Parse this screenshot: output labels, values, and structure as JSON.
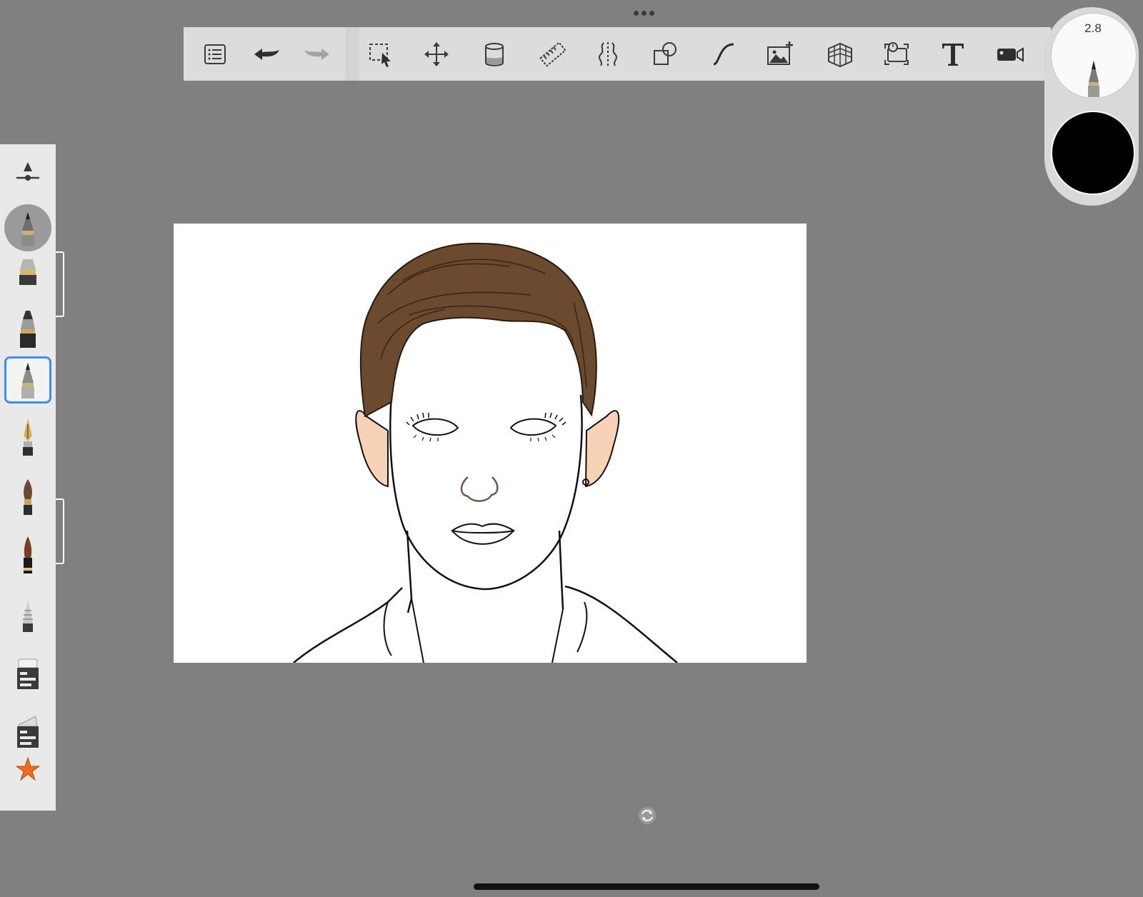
{
  "toolbar": {
    "items": [
      {
        "name": "layers-list-icon"
      },
      {
        "name": "undo-icon"
      },
      {
        "name": "redo-icon"
      },
      {
        "name": "selection-icon"
      },
      {
        "name": "transform-move-icon"
      },
      {
        "name": "fill-bucket-icon"
      },
      {
        "name": "ruler-guide-icon"
      },
      {
        "name": "symmetry-icon"
      },
      {
        "name": "shapes-icon"
      },
      {
        "name": "predictive-stroke-icon"
      },
      {
        "name": "add-image-icon"
      },
      {
        "name": "perspective-grid-icon"
      },
      {
        "name": "time-lapse-icon"
      },
      {
        "name": "text-icon"
      },
      {
        "name": "record-video-icon"
      }
    ]
  },
  "brush_panel": {
    "brushes": [
      "brush-settings",
      "pencil",
      "marker",
      "technical-pen",
      "fineliner",
      "fountain-pen",
      "paint-brush",
      "ink-brush",
      "airbrush",
      "flat-eraser",
      "soft-eraser",
      "favorites-star"
    ]
  },
  "puck": {
    "brush_size": "2.8",
    "current_color": "#000000"
  },
  "colors": {
    "background": "#808080",
    "hair": "#6b4a2f",
    "skin_blush": "#f4c7a8",
    "selection_accent": "#3f8ef0",
    "star": "#f26a21"
  }
}
